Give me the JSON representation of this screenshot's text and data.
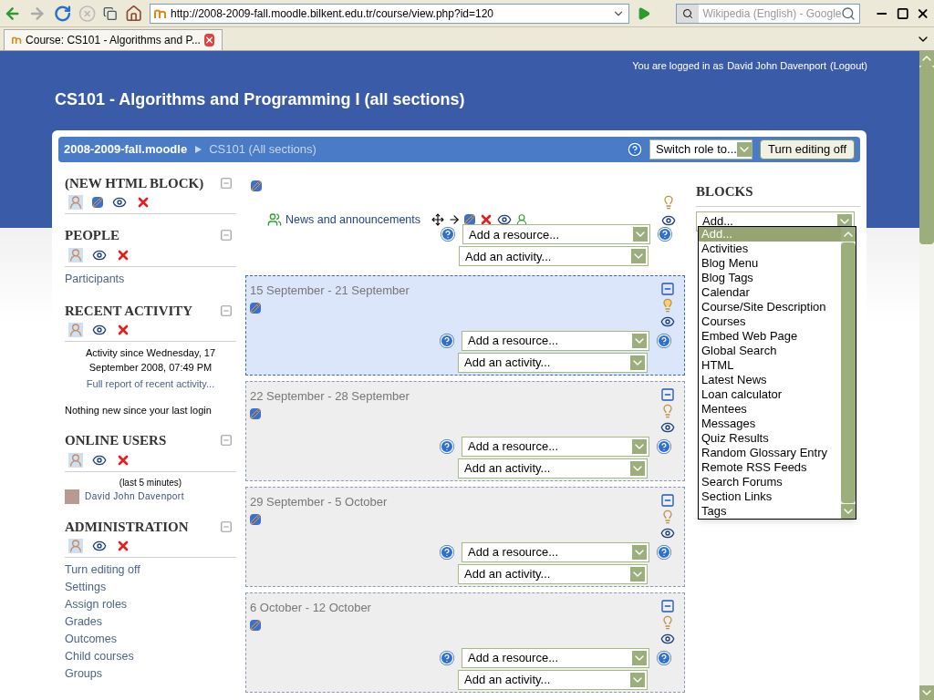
{
  "browser": {
    "url": "http://2008-2009-fall.moodle.bilkent.edu.tr/course/view.php?id=120",
    "search_placeholder": "Wikipedia (English) - Google",
    "tab_title": "Course: CS101 - Algorithms and P..."
  },
  "header": {
    "login_prefix": "You are logged in as",
    "user": "David John Davenport",
    "logout": "(Logout)",
    "title": "CS101 - Algorithms and Programming I (all sections)"
  },
  "navbar": {
    "home": "2008-2009-fall.moodle",
    "crumb": "CS101 (All sections)",
    "switch_role": "Switch role to...",
    "editing_button": "Turn editing off"
  },
  "left_blocks": [
    {
      "kind": "html",
      "title": "(NEW HTML BLOCK)",
      "editable": true
    },
    {
      "kind": "links",
      "title": "PEOPLE",
      "editable": false,
      "items": [
        "Participants"
      ]
    },
    {
      "kind": "recent",
      "title": "RECENT ACTIVITY",
      "editable": false,
      "since": "Activity since Wednesday, 17 September 2008, 07:49 PM",
      "report": "Full report of recent activity...",
      "note": "Nothing new since your last login"
    },
    {
      "kind": "online",
      "title": "ONLINE USERS",
      "editable": false,
      "period": "(last 5 minutes)",
      "users": [
        "David John Davenport"
      ]
    },
    {
      "kind": "links",
      "title": "ADMINISTRATION",
      "editable": false,
      "items": [
        "Turn editing off",
        "Settings",
        "Assign roles",
        "Grades",
        "Outcomes",
        "Child courses",
        "Groups"
      ]
    }
  ],
  "news_section": {
    "forum": "News and announcements",
    "resource": "Add a resource...",
    "activity": "Add an activity..."
  },
  "sections": [
    {
      "title": "15 September - 21 September",
      "current": true,
      "resource": "Add a resource...",
      "activity": "Add an activity..."
    },
    {
      "title": "22 September - 28 September",
      "current": false,
      "resource": "Add a resource...",
      "activity": "Add an activity..."
    },
    {
      "title": "29 September - 5 October",
      "current": false,
      "resource": "Add a resource...",
      "activity": "Add an activity..."
    },
    {
      "title": "6 October - 12 October",
      "current": false,
      "resource": "Add a resource...",
      "activity": "Add an activity..."
    }
  ],
  "blocks_panel": {
    "title": "BLOCKS",
    "value": "Add...",
    "options": [
      {
        "label": "Add...",
        "selected": true
      },
      {
        "label": "Activities",
        "selected": false
      },
      {
        "label": "Blog Menu",
        "selected": false
      },
      {
        "label": "Blog Tags",
        "selected": false
      },
      {
        "label": "Calendar",
        "selected": false
      },
      {
        "label": "Course/Site Description",
        "selected": false
      },
      {
        "label": "Courses",
        "selected": false
      },
      {
        "label": "Embed Web Page",
        "selected": false
      },
      {
        "label": "Global Search",
        "selected": false
      },
      {
        "label": "HTML",
        "selected": false
      },
      {
        "label": "Latest News",
        "selected": false
      },
      {
        "label": "Loan calculator",
        "selected": false
      },
      {
        "label": "Mentees",
        "selected": false
      },
      {
        "label": "Messages",
        "selected": false
      },
      {
        "label": "Quiz Results",
        "selected": false
      },
      {
        "label": "Random Glossary Entry",
        "selected": false
      },
      {
        "label": "Remote RSS Feeds",
        "selected": false
      },
      {
        "label": "Search Forums",
        "selected": false
      },
      {
        "label": "Section Links",
        "selected": false
      },
      {
        "label": "Tags",
        "selected": false
      }
    ]
  }
}
